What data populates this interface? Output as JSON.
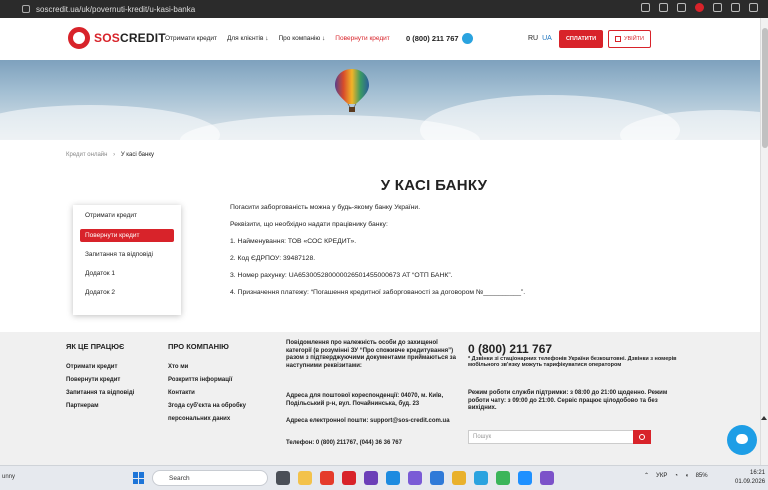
{
  "browser": {
    "url": "soscredit.ua/uk/povernuti-kredit/u-kasi-banka"
  },
  "header": {
    "logo_prefix": "SOS",
    "logo_suffix": "CREDIT",
    "nav": [
      "Отримати кредит",
      "Для клієнтів ↓",
      "Про компанію ↓",
      "Повернути кредит"
    ],
    "phone": "0 (800) 211 767",
    "lang_ru": "RU",
    "lang_ua": "UA",
    "pay_label": "СПЛАТИТИ",
    "login_label": "УВІЙТИ"
  },
  "breadcrumbs": {
    "home": "Кредит онлайн",
    "sep": "›",
    "current": "У касі банку"
  },
  "page_title": "У КАСІ БАНКУ",
  "sidebar": {
    "items": [
      "Отримати кредит",
      "Повернути кредит",
      "Запитання та відповіді",
      "Додаток 1",
      "Додаток 2"
    ],
    "active_index": 1
  },
  "content": {
    "p1": "Погасити заборгованість можна у будь-якому банку України.",
    "p2": "Реквізити, що необхідно надати працівнику банку:",
    "p3": "1. Найменування: ТОВ «СОС КРЕДИТ».",
    "p4": "2. Код ЄДРПОУ: 39487128.",
    "p5": "3. Номер рахунку: UA653005280000026501455000673 АТ “ОТП БАНК”.",
    "p6": "4. Призначення платежу: “Погашення кредитної заборгованості за договором №__________”."
  },
  "footer": {
    "col1_title": "ЯК ЦЕ ПРАЦЮЄ",
    "col1_links": [
      "Отримати кредит",
      "Повернути кредит",
      "Запитання та відповіді",
      "Партнерам"
    ],
    "col2_title": "ПРО КОМПАНІЮ",
    "col2_links": [
      "Хто ми",
      "Розкриття інформації",
      "Контакти",
      "Згода суб'єкта на обробку",
      "персональних даних"
    ],
    "notice": "Повідомлення про належність особи до захищеної категорії (в розумінні ЗУ “Про споживче кредитування”) разом з підтверджуючими документами приймаються за наступними реквізитами:",
    "address": "Адреса для поштової кореспонденції: 04070, м. Київ, Подільський р-н, вул. Почайнинська, буд. 23",
    "email": "Адреса електронної пошти: support@sos-credit.com.ua",
    "phones": "Телефон: 0 (800) 211767, (044) 36 36 767",
    "big_phone": "0 (800) 211 767",
    "note": "* Дзвінки зі стаціонарних телефонів України безкоштовні. Дзвінки з номерів мобільного зв'язку можуть тарифікуватися оператором",
    "hours": "Режим роботи служби підтримки: з 08:00 до 21:00 щоденно. Режим роботи чату: з 09:00 до 21:00. Сервіс працює цілодобово та без вихідних.",
    "search_placeholder": "Пошук"
  },
  "taskbar": {
    "weather": "unny",
    "search": "Search",
    "lang": "УКР",
    "battery": "85%",
    "time": "16:21",
    "date": "01.09.2026"
  }
}
